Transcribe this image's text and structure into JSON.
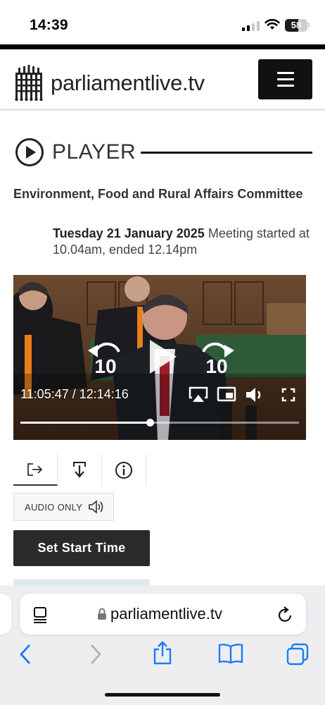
{
  "status_bar": {
    "time": "14:39",
    "battery": "58",
    "battery_level": 0.58
  },
  "header": {
    "site_name": "parliamentlive.tv",
    "logo_icon": "portcullis-icon",
    "menu_icon": "hamburger-menu-icon"
  },
  "player": {
    "heading": "PLAYER",
    "heading_icon": "play-circle-icon",
    "committee": "Environment, Food and Rural Affairs Committee",
    "date": "Tuesday 21 January 2025",
    "meeting_time": "Meeting started at 10.04am, ended 12.14pm"
  },
  "video": {
    "current_time": "11:05:47",
    "duration": "12:14:16",
    "time_display": "11:05:47 / 12:14:16",
    "progress": 0.465,
    "skip_back_seconds": "10",
    "skip_forward_seconds": "10",
    "controls": [
      "rewind-10-icon",
      "play-icon",
      "forward-10-icon",
      "airplay-icon",
      "picture-in-picture-icon",
      "volume-icon",
      "fullscreen-icon"
    ]
  },
  "tabs": [
    {
      "icon": "share-arrow-icon",
      "active": true
    },
    {
      "icon": "download-icon",
      "active": false
    },
    {
      "icon": "info-icon",
      "active": false
    }
  ],
  "audio_only": {
    "label": "AUDIO ONLY",
    "icon": "speaker-icon"
  },
  "start_button": {
    "label": "Set Start Time"
  },
  "browser": {
    "url": "parliamentlive.tv",
    "icons": [
      "reader-icon",
      "lock-icon",
      "reload-icon",
      "back-icon",
      "forward-icon",
      "share-icon",
      "bookmarks-icon",
      "tabs-icon"
    ],
    "accent": "#1a7cf5"
  }
}
